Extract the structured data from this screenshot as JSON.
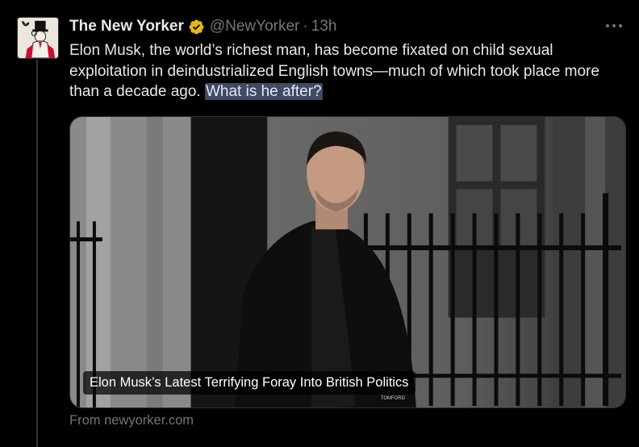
{
  "tweet": {
    "author_name": "The New Yorker",
    "handle": "@NewYorker",
    "separator": "·",
    "time": "13h",
    "text_plain": "Elon Musk, the world’s richest man, has become fixated on child sexual exploitation in deindustrialized English towns—much of which took place more than a decade ago.",
    "text_highlight": "What is he after?"
  },
  "card": {
    "title": "Elon Musk’s Latest Terrifying Foray Into British Politics",
    "source": "From newyorker.com",
    "shirt_label": "TOMFORD"
  },
  "icons": {
    "verified": "verified-gold-badge-icon",
    "more": "more-options-icon",
    "avatar": "new-yorker-logo-avatar"
  },
  "colors": {
    "background": "#000000",
    "text": "#e7e9ea",
    "muted": "#71767b",
    "highlight": "#3d4b66",
    "verified_gold": "#e2b719",
    "divider": "#2f3336"
  }
}
